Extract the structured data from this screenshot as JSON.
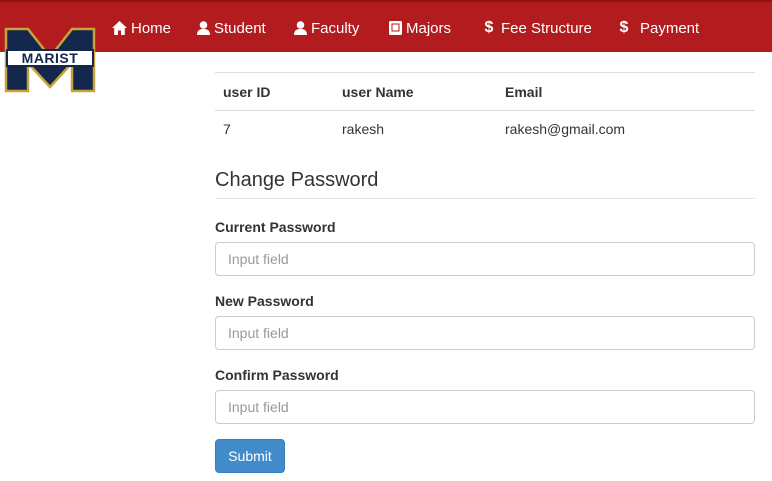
{
  "nav": {
    "items": [
      {
        "label": "Home",
        "icon": "home-icon"
      },
      {
        "label": "Student",
        "icon": "user-icon"
      },
      {
        "label": "Faculty",
        "icon": "user-icon"
      },
      {
        "label": "Majors",
        "icon": "book-icon"
      },
      {
        "label": "Fee Structure",
        "icon": "dollar-icon"
      },
      {
        "label": "Payment",
        "icon": "dollar-icon"
      }
    ],
    "dollar_glyph": "$"
  },
  "logo": {
    "text": "MARIST"
  },
  "user_table": {
    "headers": [
      "user ID",
      "user Name",
      "Email"
    ],
    "rows": [
      [
        "7",
        "rakesh",
        "rakesh@gmail.com"
      ]
    ]
  },
  "change_password": {
    "title": "Change Password",
    "current_label": "Current Password",
    "new_label": "New Password",
    "confirm_label": "Confirm Password",
    "placeholder": "Input field",
    "submit_label": "Submit"
  },
  "colors": {
    "navbar": "#b21c1f",
    "logo_navy": "#13284c",
    "logo_gold": "#c8a23c",
    "button": "#428bca"
  }
}
